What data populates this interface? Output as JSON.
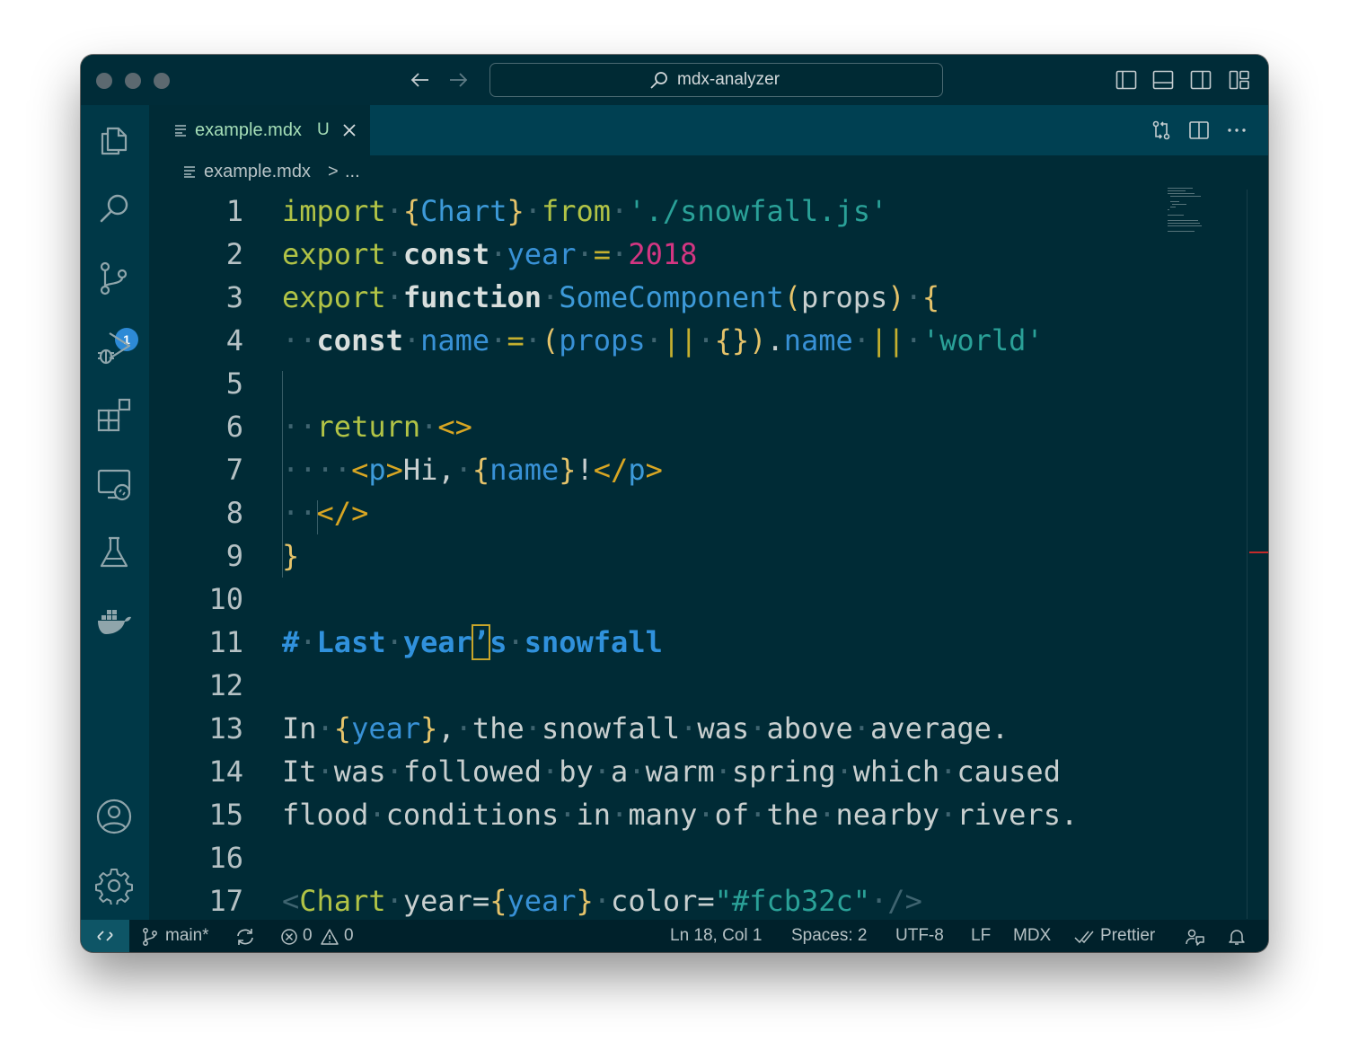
{
  "window": {
    "title": "mdx-analyzer",
    "traffic_lights": [
      "close",
      "minimize",
      "zoom"
    ],
    "nav": {
      "back_icon": "arrow-left-icon",
      "forward_icon": "arrow-right-icon"
    }
  },
  "layout_controls": [
    "toggle-primary-sidebar-icon",
    "toggle-panel-icon",
    "toggle-secondary-sidebar-icon",
    "customize-layout-icon"
  ],
  "activity_bar": {
    "items": [
      {
        "name": "explorer",
        "icon": "files-icon"
      },
      {
        "name": "search",
        "icon": "search-icon"
      },
      {
        "name": "source-control",
        "icon": "source-control-icon",
        "badge": "1"
      },
      {
        "name": "run-and-debug",
        "icon": "run-debug-icon"
      },
      {
        "name": "extensions",
        "icon": "extensions-icon"
      },
      {
        "name": "remote-explorer",
        "icon": "remote-explorer-icon"
      },
      {
        "name": "testing",
        "icon": "beaker-icon"
      },
      {
        "name": "docker",
        "icon": "docker-icon"
      }
    ],
    "bottom": [
      {
        "name": "accounts",
        "icon": "account-icon"
      },
      {
        "name": "manage",
        "icon": "gear-icon"
      }
    ]
  },
  "tabs": [
    {
      "label": "example.mdx",
      "status": "U",
      "active": true
    }
  ],
  "editor_actions": [
    "open-changes-icon",
    "split-editor-icon",
    "more-actions-icon"
  ],
  "breadcrumb": {
    "file": "example.mdx",
    "separator": ">",
    "more": "..."
  },
  "editor": {
    "line_numbers": [
      "1",
      "2",
      "3",
      "4",
      "5",
      "6",
      "7",
      "8",
      "9",
      "10",
      "11",
      "12",
      "13",
      "14",
      "15",
      "16",
      "17"
    ],
    "lines": [
      "import {Chart} from './snowfall.js'",
      "export const year = 2018",
      "export function SomeComponent(props) {",
      "  const name = (props || {}).name || 'world'",
      "",
      "  return <>",
      "    <p>Hi, {name}!</p>",
      "  </>",
      "}",
      "",
      "# Last year's snowfall",
      "",
      "In {year}, the snowfall was above average.",
      "It was followed by a warm spring which caused",
      "flood conditions in many of the nearby rivers.",
      "",
      "<Chart year={year} color=\"#fcb32c\" />"
    ],
    "theme_colors": {
      "background": "#002b36",
      "keyword": "#b1c346",
      "identifier": "#3d9ad9",
      "string": "#2aa198",
      "number": "#d33682",
      "brace": "#e5c36a",
      "tag": "#d8a623"
    }
  },
  "status_bar": {
    "remote_icon": "remote-icon",
    "branch": "main*",
    "sync_icon": "sync-icon",
    "errors": "0",
    "warnings": "0",
    "position": "Ln 18, Col 1",
    "indentation": "Spaces: 2",
    "encoding": "UTF-8",
    "eol": "LF",
    "language": "MDX",
    "formatter": "Prettier",
    "feedback_icon": "feedback-icon",
    "notifications_icon": "bell-icon"
  }
}
